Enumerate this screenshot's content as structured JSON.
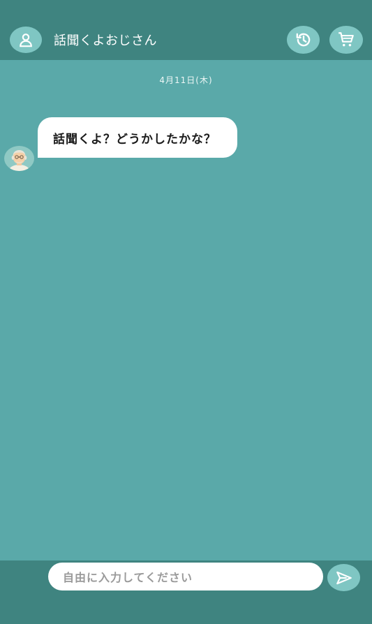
{
  "header": {
    "title": "話聞くよおじさん",
    "icons": [
      "user-icon",
      "history-icon",
      "cart-icon"
    ]
  },
  "chat": {
    "date": "4月11日(木)",
    "messages": [
      {
        "sender": "bot",
        "text": "話聞くよ？どうかしたかな？"
      }
    ]
  },
  "composer": {
    "placeholder": "自由に入力してください",
    "send_icon": "send-icon"
  },
  "colors": {
    "header_bg": "#3f8480",
    "chat_bg": "#5aa9a9",
    "button_bg": "#7fc6c3",
    "bubble_bg": "#ffffff"
  }
}
